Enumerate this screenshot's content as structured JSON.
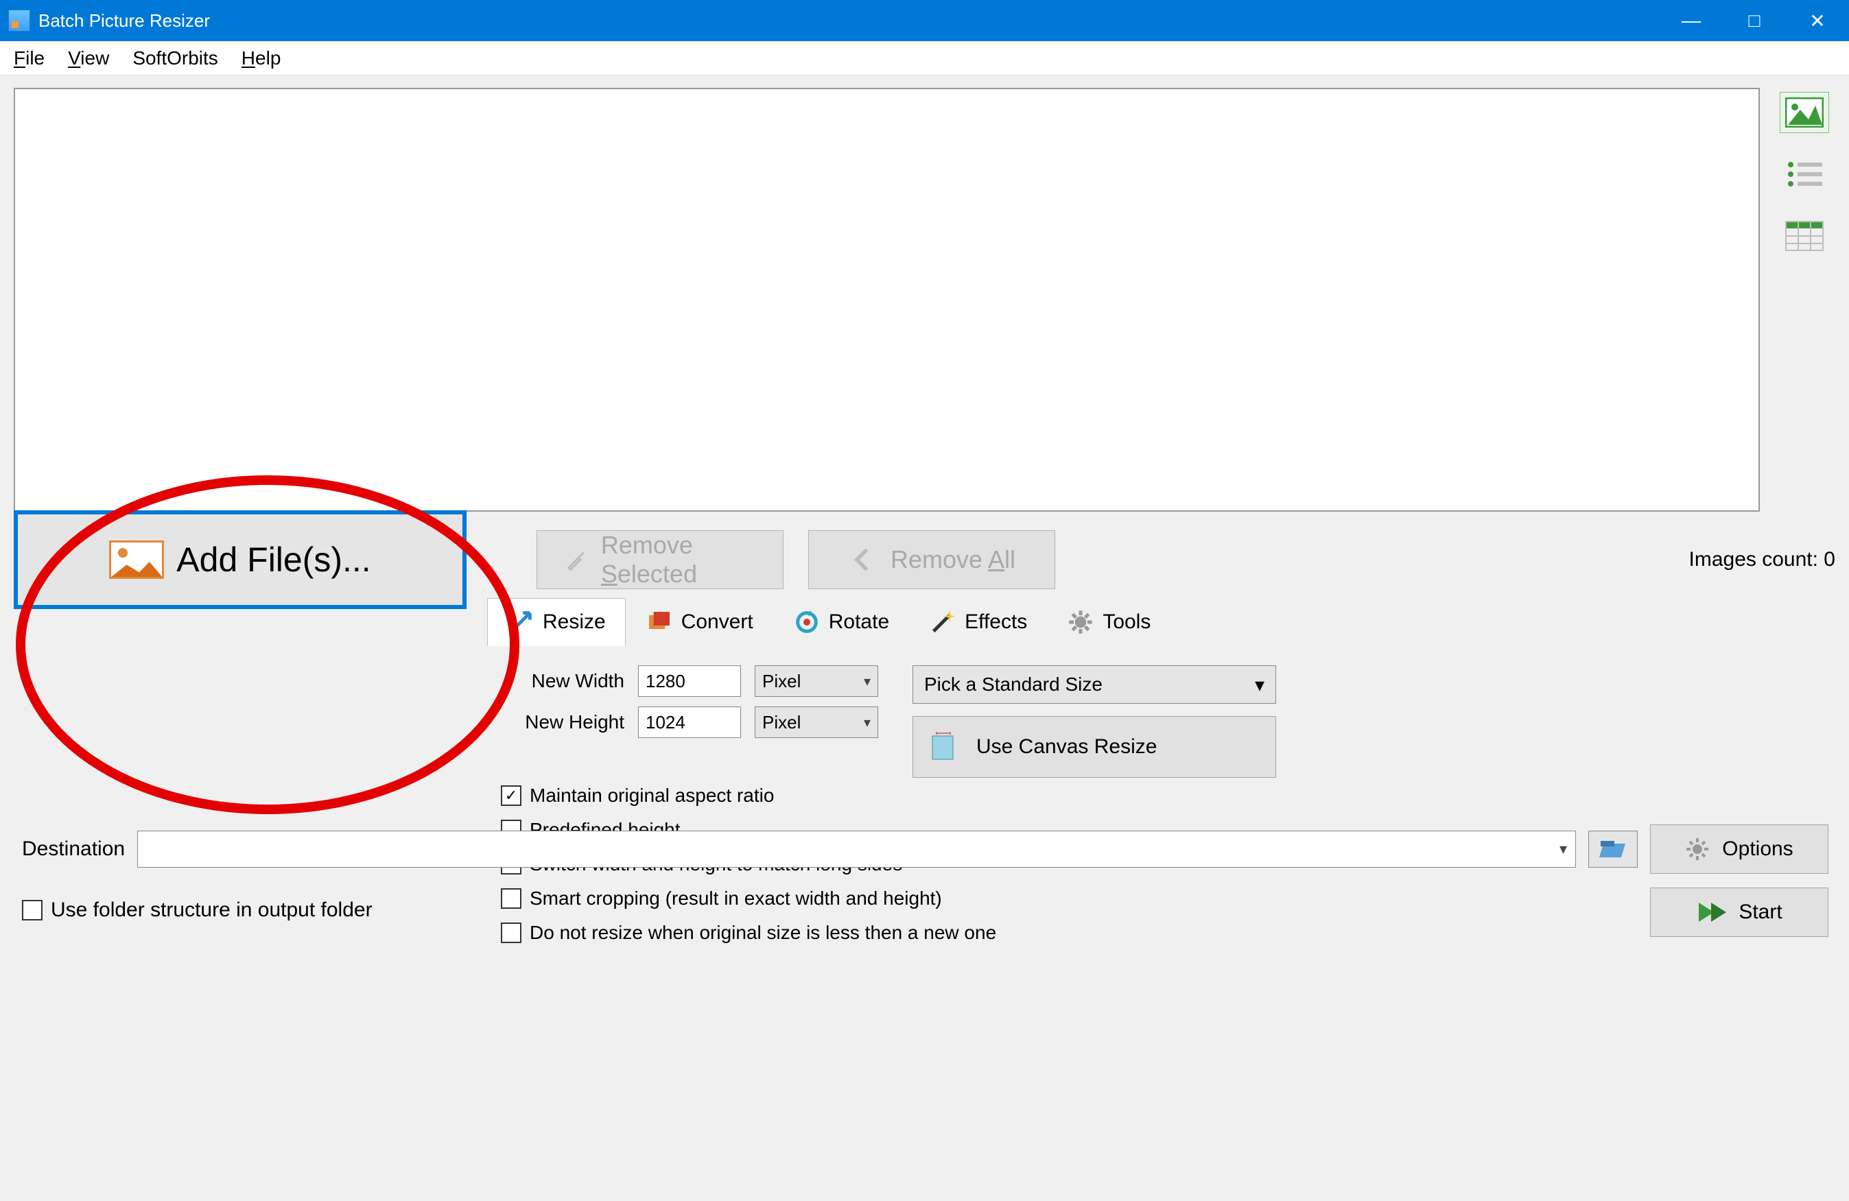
{
  "title": "Batch Picture Resizer",
  "menu": {
    "file": "File",
    "view": "View",
    "softorbits": "SoftOrbits",
    "help": "Help"
  },
  "buttons": {
    "add_files": "Add File(s)...",
    "remove_selected": "Remove Selected",
    "remove_all": "Remove All",
    "images_count": "Images count: 0",
    "options": "Options",
    "start": "Start",
    "browse_tooltip": "Browse",
    "use_canvas": "Use Canvas Resize"
  },
  "tabs": {
    "resize": "Resize",
    "convert": "Convert",
    "rotate": "Rotate",
    "effects": "Effects",
    "tools": "Tools"
  },
  "resize": {
    "new_width_label": "New Width",
    "new_width_value": "1280",
    "new_height_label": "New Height",
    "new_height_value": "1024",
    "unit_w": "Pixel",
    "unit_h": "Pixel",
    "pick_size": "Pick a Standard Size",
    "maintain": "Maintain original aspect ratio",
    "predefined": "Predefined height",
    "switch": "Switch width and height to match long sides",
    "smart": "Smart cropping (result in exact width and height)",
    "dont_resize": "Do not resize when original size is less then a new one"
  },
  "dest": {
    "label": "Destination",
    "value": "",
    "use_folder_structure": "Use folder structure in output folder"
  },
  "window_controls": {
    "min": "—",
    "max": "□",
    "close": "✕"
  }
}
